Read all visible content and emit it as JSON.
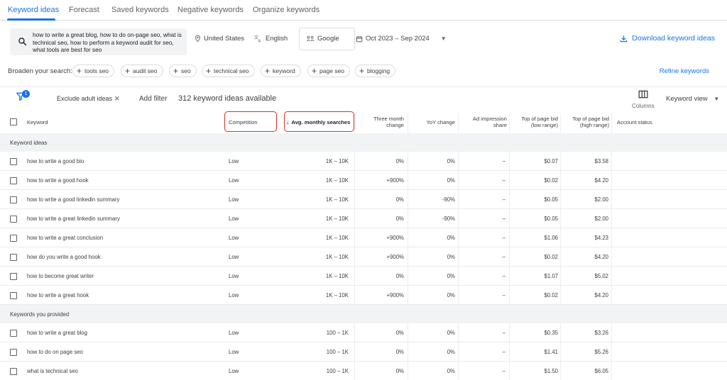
{
  "tabs": [
    {
      "label": "Keyword ideas",
      "active": true
    },
    {
      "label": "Forecast",
      "active": false
    },
    {
      "label": "Saved keywords",
      "active": false
    },
    {
      "label": "Negative keywords",
      "active": false
    },
    {
      "label": "Organize keywords",
      "active": false
    }
  ],
  "search": {
    "query": "how to write a great blog, how to do on-page seo, what is technical seo, how to perform a keyword audit for seo, what tools are best for seo",
    "location": "United States",
    "language": "English",
    "engine": "Google",
    "date_range": "Oct 2023 – Sep 2024",
    "download_label": "Download keyword ideas"
  },
  "broaden": {
    "label": "Broaden your search:",
    "chips": [
      "tools seo",
      "audit seo",
      "seo",
      "technical seo",
      "keyword",
      "page seo",
      "blogging"
    ],
    "refine_label": "Refine keywords"
  },
  "filterbar": {
    "filter_count": "1",
    "exclude_label": "Exclude adult ideas",
    "add_filter": "Add filter",
    "idea_count": "312 keyword ideas available",
    "columns_label": "Columns",
    "view_label": "Keyword view"
  },
  "table": {
    "headers": {
      "keyword": "Keyword",
      "competition": "Competition",
      "avg_monthly": "Avg. monthly searches",
      "three_month": "Three month change",
      "yoy": "YoY change",
      "ad_impression": "Ad impression share",
      "bid_low": "Top of page bid (low range)",
      "bid_high": "Top of page bid (high range)",
      "account_status": "Account status"
    },
    "sections": [
      {
        "title": "Keyword ideas",
        "rows": [
          {
            "keyword": "how to write a good bio",
            "competition": "Low",
            "searches": "1K – 10K",
            "three_month": "0%",
            "yoy": "0%",
            "ad_impression": "–",
            "bid_low": "$0.07",
            "bid_high": "$3.58"
          },
          {
            "keyword": "how to write a good hook",
            "competition": "Low",
            "searches": "1K – 10K",
            "three_month": "+900%",
            "yoy": "0%",
            "ad_impression": "–",
            "bid_low": "$0.02",
            "bid_high": "$4.20"
          },
          {
            "keyword": "how to write a good linkedin summary",
            "competition": "Low",
            "searches": "1K – 10K",
            "three_month": "0%",
            "yoy": "-90%",
            "ad_impression": "–",
            "bid_low": "$0.05",
            "bid_high": "$2.00"
          },
          {
            "keyword": "how to write a great linkedin summary",
            "competition": "Low",
            "searches": "1K – 10K",
            "three_month": "0%",
            "yoy": "-90%",
            "ad_impression": "–",
            "bid_low": "$0.05",
            "bid_high": "$2.00"
          },
          {
            "keyword": "how to write a great conclusion",
            "competition": "Low",
            "searches": "1K – 10K",
            "three_month": "+900%",
            "yoy": "0%",
            "ad_impression": "–",
            "bid_low": "$1.06",
            "bid_high": "$4.23"
          },
          {
            "keyword": "how do you write a good hook",
            "competition": "Low",
            "searches": "1K – 10K",
            "three_month": "+900%",
            "yoy": "0%",
            "ad_impression": "–",
            "bid_low": "$0.02",
            "bid_high": "$4.20"
          },
          {
            "keyword": "how to become great writer",
            "competition": "Low",
            "searches": "1K – 10K",
            "three_month": "0%",
            "yoy": "0%",
            "ad_impression": "–",
            "bid_low": "$1.07",
            "bid_high": "$5.02"
          },
          {
            "keyword": "how to write a great hook",
            "competition": "Low",
            "searches": "1K – 10K",
            "three_month": "+900%",
            "yoy": "0%",
            "ad_impression": "–",
            "bid_low": "$0.02",
            "bid_high": "$4.20"
          }
        ]
      },
      {
        "title": "Keywords you provided",
        "rows": [
          {
            "keyword": "how to write a great blog",
            "competition": "Low",
            "searches": "100 – 1K",
            "three_month": "0%",
            "yoy": "0%",
            "ad_impression": "–",
            "bid_low": "$0.35",
            "bid_high": "$3.26"
          },
          {
            "keyword": "how to do on page seo",
            "competition": "Low",
            "searches": "100 – 1K",
            "three_month": "0%",
            "yoy": "0%",
            "ad_impression": "–",
            "bid_low": "$1.41",
            "bid_high": "$5.26"
          },
          {
            "keyword": "what is technical seo",
            "competition": "Low",
            "searches": "100 – 1K",
            "three_month": "0%",
            "yoy": "0%",
            "ad_impression": "–",
            "bid_low": "$1.50",
            "bid_high": "$6.05"
          }
        ]
      }
    ]
  },
  "colors": {
    "accent": "#1a73e8",
    "highlight": "#d93025",
    "section_bg": "#f1f3f4"
  }
}
